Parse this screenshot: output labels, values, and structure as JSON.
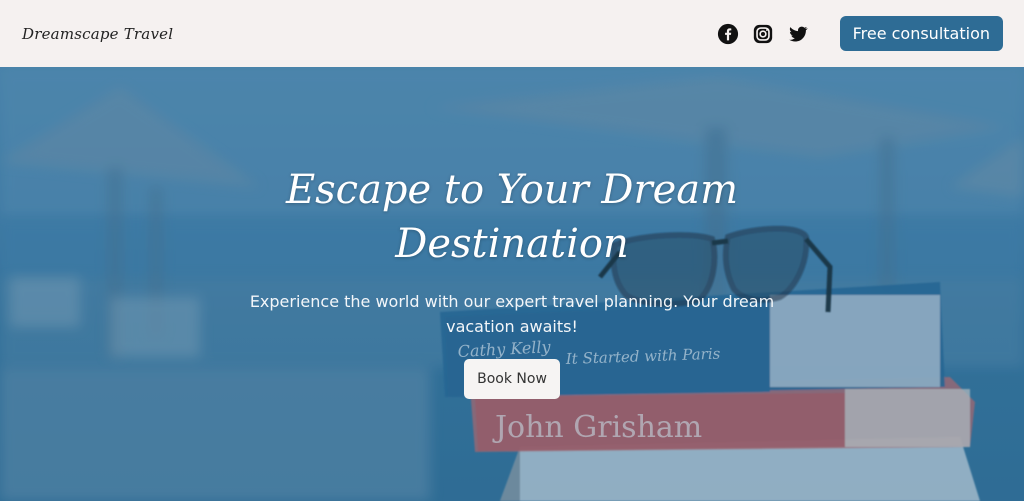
{
  "header": {
    "logo": "Dreamscape Travel",
    "social": [
      {
        "icon": "facebook-icon"
      },
      {
        "icon": "instagram-icon"
      },
      {
        "icon": "twitter-icon"
      }
    ],
    "cta_label": "Free consultation"
  },
  "hero": {
    "title": "Escape to Your Dream Destination",
    "subtitle": "Experience the world with our expert travel planning. Your dream vacation awaits!",
    "button_label": "Book Now",
    "book_titles": [
      "It Started with Paris",
      "John Grisham"
    ]
  },
  "colors": {
    "accent": "#2e6c95",
    "header_bg": "#f5f1f0",
    "overlay": "#3b78a2"
  }
}
